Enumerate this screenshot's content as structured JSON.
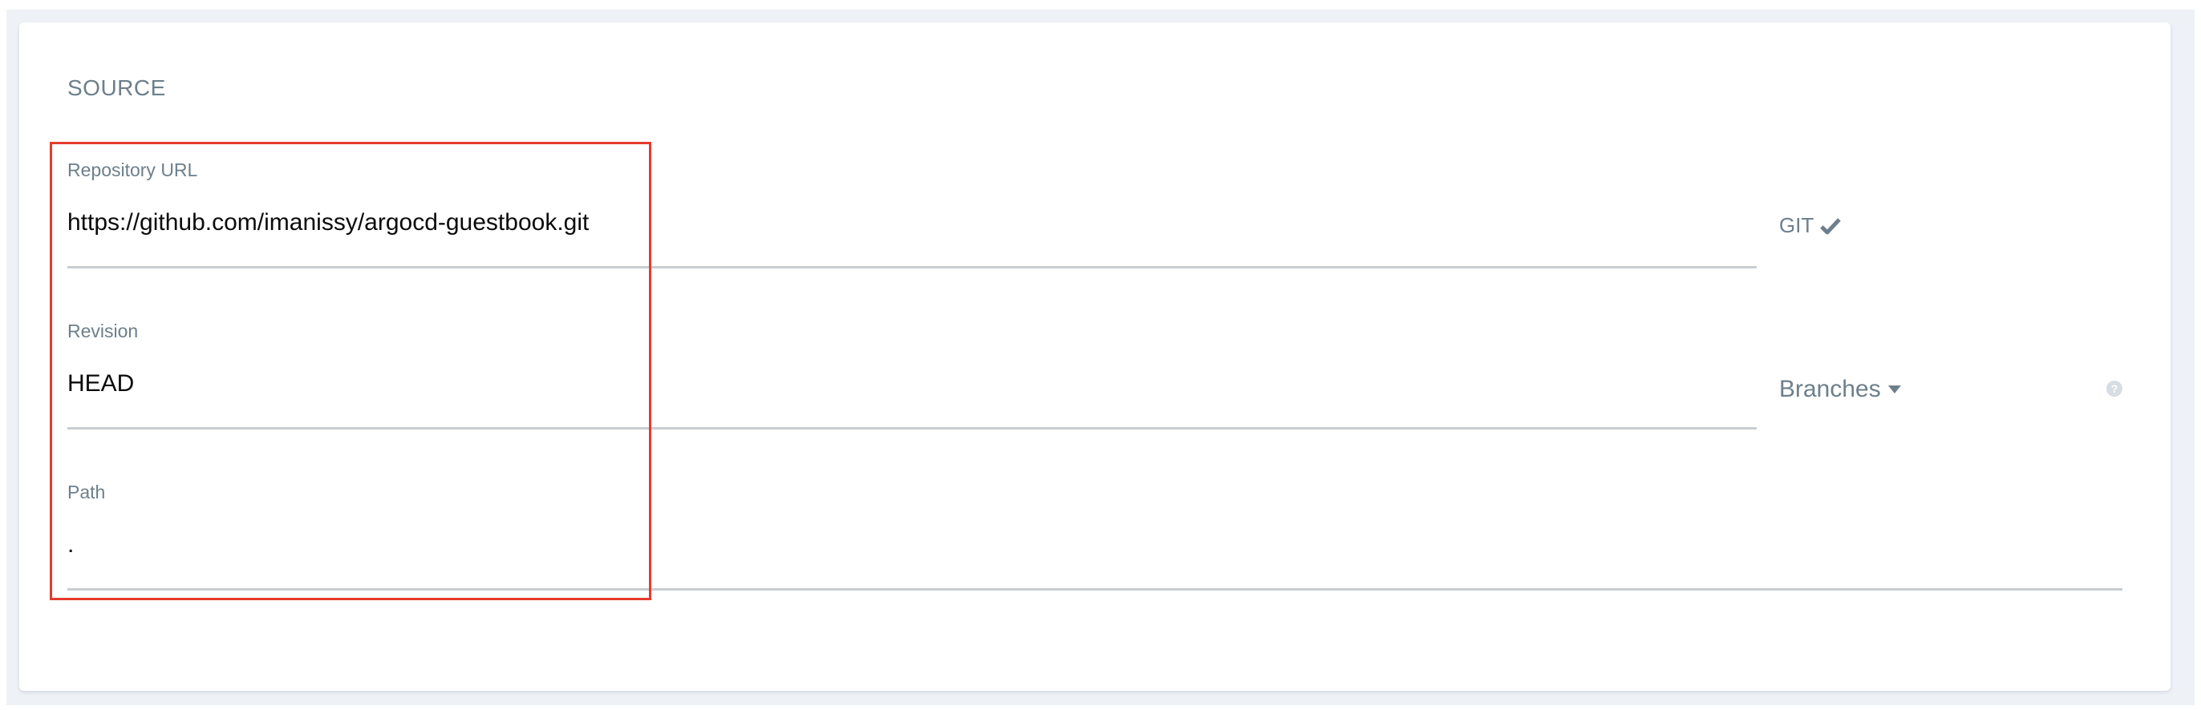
{
  "section": {
    "title": "SOURCE"
  },
  "fields": {
    "repository_url": {
      "label": "Repository URL",
      "value": "https://github.com/imanissy/argocd-guestbook.git"
    },
    "revision": {
      "label": "Revision",
      "value": "HEAD"
    },
    "path": {
      "label": "Path",
      "value": "."
    }
  },
  "repo_type": {
    "label": "GIT",
    "icon": "check-icon"
  },
  "revision_type": {
    "label": "Branches",
    "icon": "caret-down-icon"
  },
  "help": {
    "icon": "question-circle-icon",
    "glyph": "?"
  },
  "colors": {
    "label": "#6d7f8b",
    "value": "#0b0b0b",
    "underline": "#c9cdd1",
    "highlight": "#e53b2c",
    "background": "#eef1f5"
  }
}
